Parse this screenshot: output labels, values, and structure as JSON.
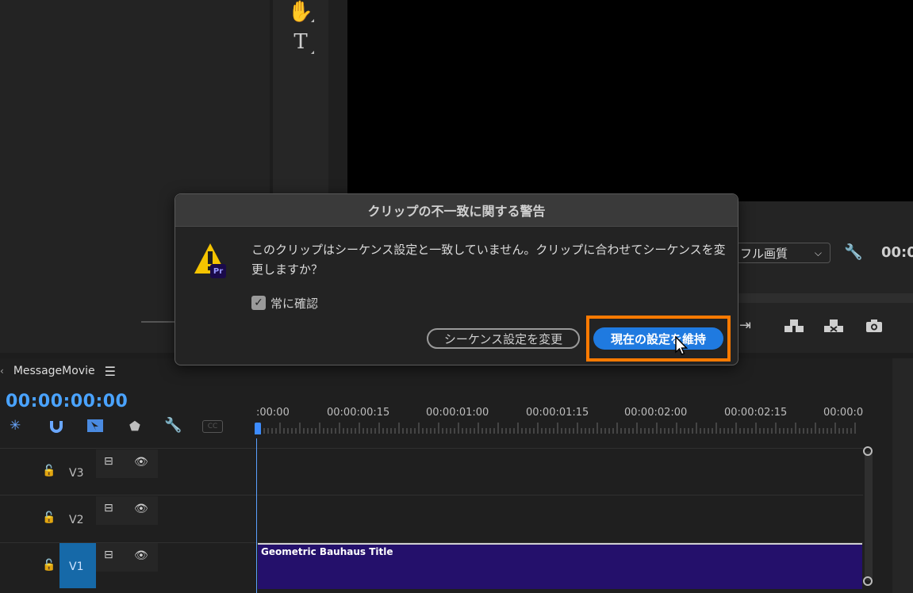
{
  "dialog": {
    "title": "クリップの不一致に関する警告",
    "message": "このクリップはシーケンス設定と一致していません。クリップに合わせてシーケンスを変更しますか？",
    "checkbox_label": "常に確認",
    "checkbox_checked": true,
    "pr_badge": "Pr",
    "change_button": "シーケンス設定を変更",
    "keep_button": "現在の設定を維持"
  },
  "program": {
    "quality_value": "フル画質",
    "timecode_partial": "00:0"
  },
  "timeline": {
    "sequence_name": "MessageMovie",
    "timecode": "00:00:00:00",
    "ruler": [
      ":00:00",
      "00:00:00:15",
      "00:00:01:00",
      "00:00:01:15",
      "00:00:02:00",
      "00:00:02:15",
      "00:00:0"
    ],
    "tracks": [
      {
        "name": "V3"
      },
      {
        "name": "V2"
      },
      {
        "name": "V1"
      }
    ],
    "clip_title": "Geometric Bauhaus Title"
  },
  "colors": {
    "accent_blue": "#1f7ae0",
    "highlight_orange": "#ff7a00",
    "clip_purple": "#24106b",
    "timecode_blue": "#4aa3ff"
  },
  "icons": [
    "hand-icon",
    "type-icon",
    "warning-icon",
    "wrench-icon",
    "camera-icon",
    "lock-icon",
    "eye-icon",
    "marker-icon",
    "magnet-icon",
    "snap-icon",
    "cc-icon"
  ]
}
